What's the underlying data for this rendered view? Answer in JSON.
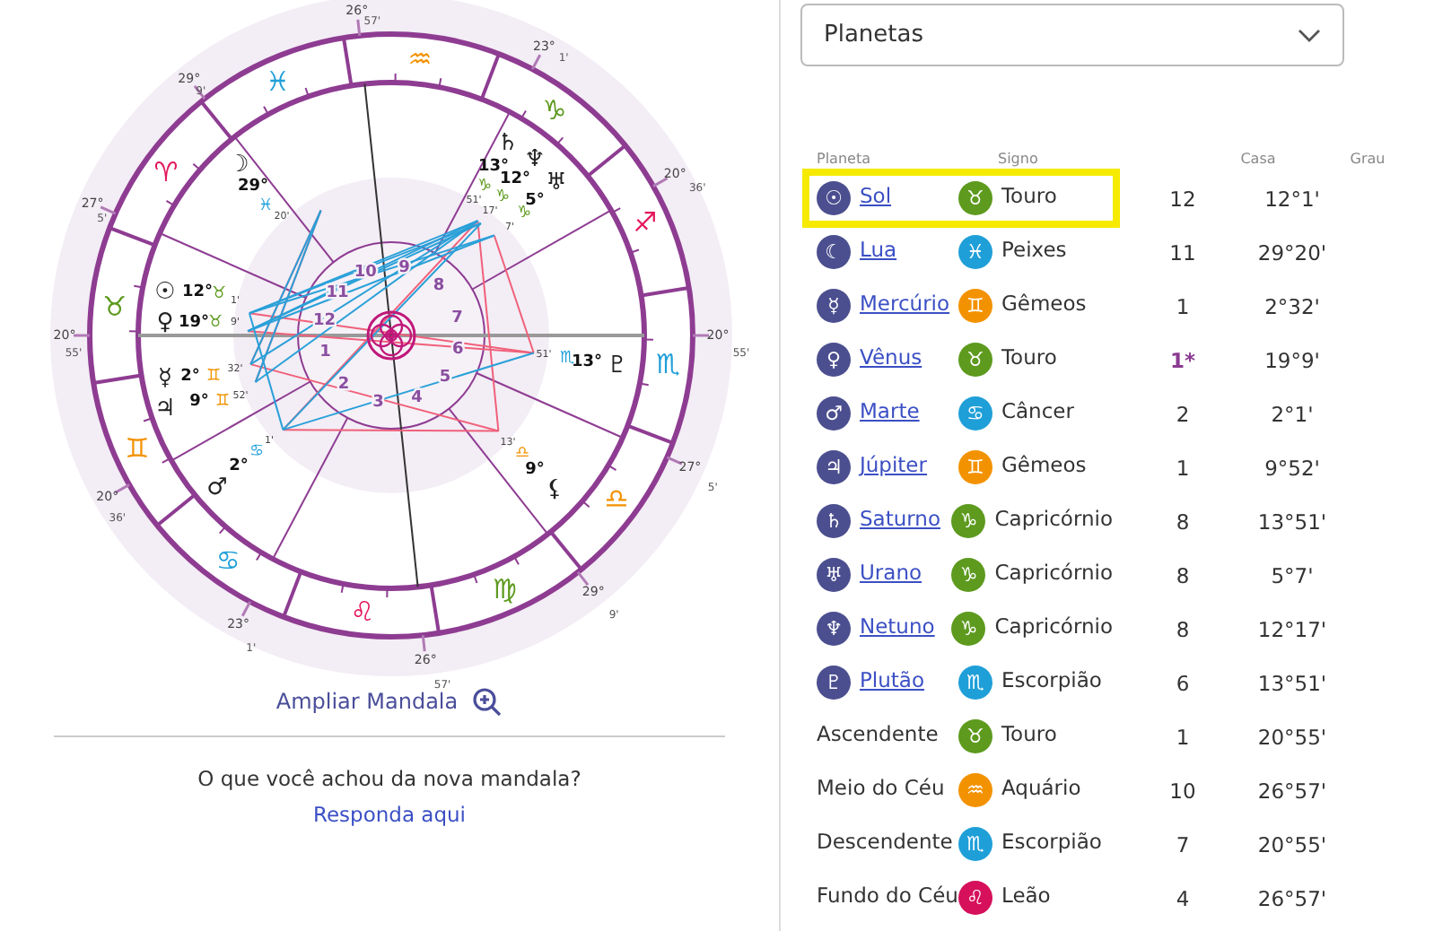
{
  "chart": {
    "signs": [
      {
        "glyph": "♈",
        "color": "#e3165b"
      },
      {
        "glyph": "♉",
        "color": "#5d9a1e"
      },
      {
        "glyph": "♊",
        "color": "#f39200"
      },
      {
        "glyph": "♋",
        "color": "#1f9fd8"
      },
      {
        "glyph": "♌",
        "color": "#e3165b"
      },
      {
        "glyph": "♍",
        "color": "#5d9a1e"
      },
      {
        "glyph": "♎",
        "color": "#f39200"
      },
      {
        "glyph": "♏",
        "color": "#1f9fd8"
      },
      {
        "glyph": "♐",
        "color": "#e3165b"
      },
      {
        "glyph": "♑",
        "color": "#5d9a1e"
      },
      {
        "glyph": "♒",
        "color": "#f39200"
      },
      {
        "glyph": "♓",
        "color": "#1f9fd8"
      }
    ],
    "cusps": [
      {
        "degrees": "20°",
        "minutes": "55'"
      },
      {
        "degrees": "20°",
        "minutes": "36'"
      },
      {
        "degrees": "23°",
        "minutes": "1'"
      },
      {
        "degrees": "26°",
        "minutes": "57'"
      },
      {
        "degrees": "29°",
        "minutes": "9'"
      },
      {
        "degrees": "27°",
        "minutes": "5'"
      },
      {
        "degrees": "20°",
        "minutes": "55'"
      },
      {
        "degrees": "20°",
        "minutes": "36'"
      },
      {
        "degrees": "23°",
        "minutes": "1'"
      },
      {
        "degrees": "26°",
        "minutes": "57'"
      },
      {
        "degrees": "29°",
        "minutes": "9'"
      },
      {
        "degrees": "27°",
        "minutes": "5'"
      }
    ],
    "houses": [
      "1",
      "2",
      "3",
      "4",
      "5",
      "6",
      "7",
      "8",
      "9",
      "10",
      "11",
      "12"
    ],
    "planets": [
      {
        "symbol": "♄",
        "degrees": "13°",
        "sign": "♑",
        "color": "#5d9a1e",
        "minutes": "51'"
      },
      {
        "symbol": "♆",
        "degrees": "12°",
        "sign": "♑",
        "color": "#5d9a1e",
        "minutes": "17'"
      },
      {
        "symbol": "☽",
        "degrees": "29°",
        "sign": "♓",
        "color": "#1f9fd8",
        "minutes": "20'"
      },
      {
        "symbol": "♅",
        "degrees": "5°",
        "sign": "♑",
        "color": "#5d9a1e",
        "minutes": "7'"
      },
      {
        "symbol": "☉",
        "degrees": "12°",
        "sign": "♉",
        "color": "#5d9a1e",
        "minutes": "1'"
      },
      {
        "symbol": "♀",
        "degrees": "19°",
        "sign": "♉",
        "color": "#5d9a1e",
        "minutes": "9'"
      },
      {
        "symbol": "♇",
        "degrees": "13°",
        "sign": "♏",
        "color": "#1f9fd8",
        "minutes": "51'"
      },
      {
        "symbol": "☿",
        "degrees": "2°",
        "sign": "♊",
        "color": "#f39200",
        "minutes": "32'"
      },
      {
        "symbol": "♃",
        "degrees": "9°",
        "sign": "♊",
        "color": "#f39200",
        "minutes": "52'"
      },
      {
        "symbol": "♂",
        "degrees": "2°",
        "sign": "♋",
        "color": "#1f9fd8",
        "minutes": "1'"
      },
      {
        "symbol": "⚸",
        "degrees": "9°",
        "sign": "♎",
        "color": "#f39200",
        "minutes": "13'"
      }
    ]
  },
  "expand_link": "Ampliar Mandala",
  "feedback": {
    "question": "O que você achou da nova mandala?",
    "link": "Responda aqui"
  },
  "dropdown": {
    "value": "Planetas"
  },
  "table": {
    "columns": [
      "Planeta",
      "Signo",
      "Casa",
      "Grau"
    ],
    "rows": [
      {
        "kind": "planet",
        "symbol": "☉",
        "name": "Sol",
        "sign_symbol": "♉",
        "sign": "Touro",
        "color": "#5d9a1e",
        "house": "12",
        "degree": "12°1'",
        "highlighted": true,
        "emphasized": false
      },
      {
        "kind": "planet",
        "symbol": "☾",
        "name": "Lua",
        "sign_symbol": "♓",
        "sign": "Peixes",
        "color": "#1f9fd8",
        "house": "11",
        "degree": "29°20'",
        "highlighted": false,
        "emphasized": false
      },
      {
        "kind": "planet",
        "symbol": "☿",
        "name": "Mercúrio",
        "sign_symbol": "♊",
        "sign": "Gêmeos",
        "color": "#f39200",
        "house": "1",
        "degree": "2°32'",
        "highlighted": false,
        "emphasized": false
      },
      {
        "kind": "planet",
        "symbol": "♀",
        "name": "Vênus",
        "sign_symbol": "♉",
        "sign": "Touro",
        "color": "#5d9a1e",
        "house": "1*",
        "degree": "19°9'",
        "highlighted": false,
        "emphasized": true
      },
      {
        "kind": "planet",
        "symbol": "♂",
        "name": "Marte",
        "sign_symbol": "♋",
        "sign": "Câncer",
        "color": "#1f9fd8",
        "house": "2",
        "degree": "2°1'",
        "highlighted": false,
        "emphasized": false
      },
      {
        "kind": "planet",
        "symbol": "♃",
        "name": "Júpiter",
        "sign_symbol": "♊",
        "sign": "Gêmeos",
        "color": "#f39200",
        "house": "1",
        "degree": "9°52'",
        "highlighted": false,
        "emphasized": false
      },
      {
        "kind": "planet",
        "symbol": "♄",
        "name": "Saturno",
        "sign_symbol": "♑",
        "sign": "Capricórnio",
        "color": "#5d9a1e",
        "house": "8",
        "degree": "13°51'",
        "highlighted": false,
        "emphasized": false
      },
      {
        "kind": "planet",
        "symbol": "♅",
        "name": "Urano",
        "sign_symbol": "♑",
        "sign": "Capricórnio",
        "color": "#5d9a1e",
        "house": "8",
        "degree": "5°7'",
        "highlighted": false,
        "emphasized": false
      },
      {
        "kind": "planet",
        "symbol": "♆",
        "name": "Netuno",
        "sign_symbol": "♑",
        "sign": "Capricórnio",
        "color": "#5d9a1e",
        "house": "8",
        "degree": "12°17'",
        "highlighted": false,
        "emphasized": false
      },
      {
        "kind": "planet",
        "symbol": "♇",
        "name": "Plutão",
        "sign_symbol": "♏",
        "sign": "Escorpião",
        "color": "#1f9fd8",
        "house": "6",
        "degree": "13°51'",
        "highlighted": false,
        "emphasized": false
      },
      {
        "kind": "angle",
        "name": "Ascendente",
        "sign_symbol": "♉",
        "sign": "Touro",
        "color": "#5d9a1e",
        "house": "1",
        "degree": "20°55'",
        "highlighted": false,
        "emphasized": false
      },
      {
        "kind": "angle",
        "name": "Meio do Céu",
        "sign_symbol": "♒",
        "sign": "Aquário",
        "color": "#f39200",
        "house": "10",
        "degree": "26°57'",
        "highlighted": false,
        "emphasized": false
      },
      {
        "kind": "angle",
        "name": "Descendente",
        "sign_symbol": "♏",
        "sign": "Escorpião",
        "color": "#1f9fd8",
        "house": "7",
        "degree": "20°55'",
        "highlighted": false,
        "emphasized": false
      },
      {
        "kind": "angle",
        "name": "Fundo do Céu",
        "sign_symbol": "♌",
        "sign": "Leão",
        "color": "#d6105b",
        "house": "4",
        "degree": "26°57'",
        "highlighted": false,
        "emphasized": false
      }
    ]
  }
}
